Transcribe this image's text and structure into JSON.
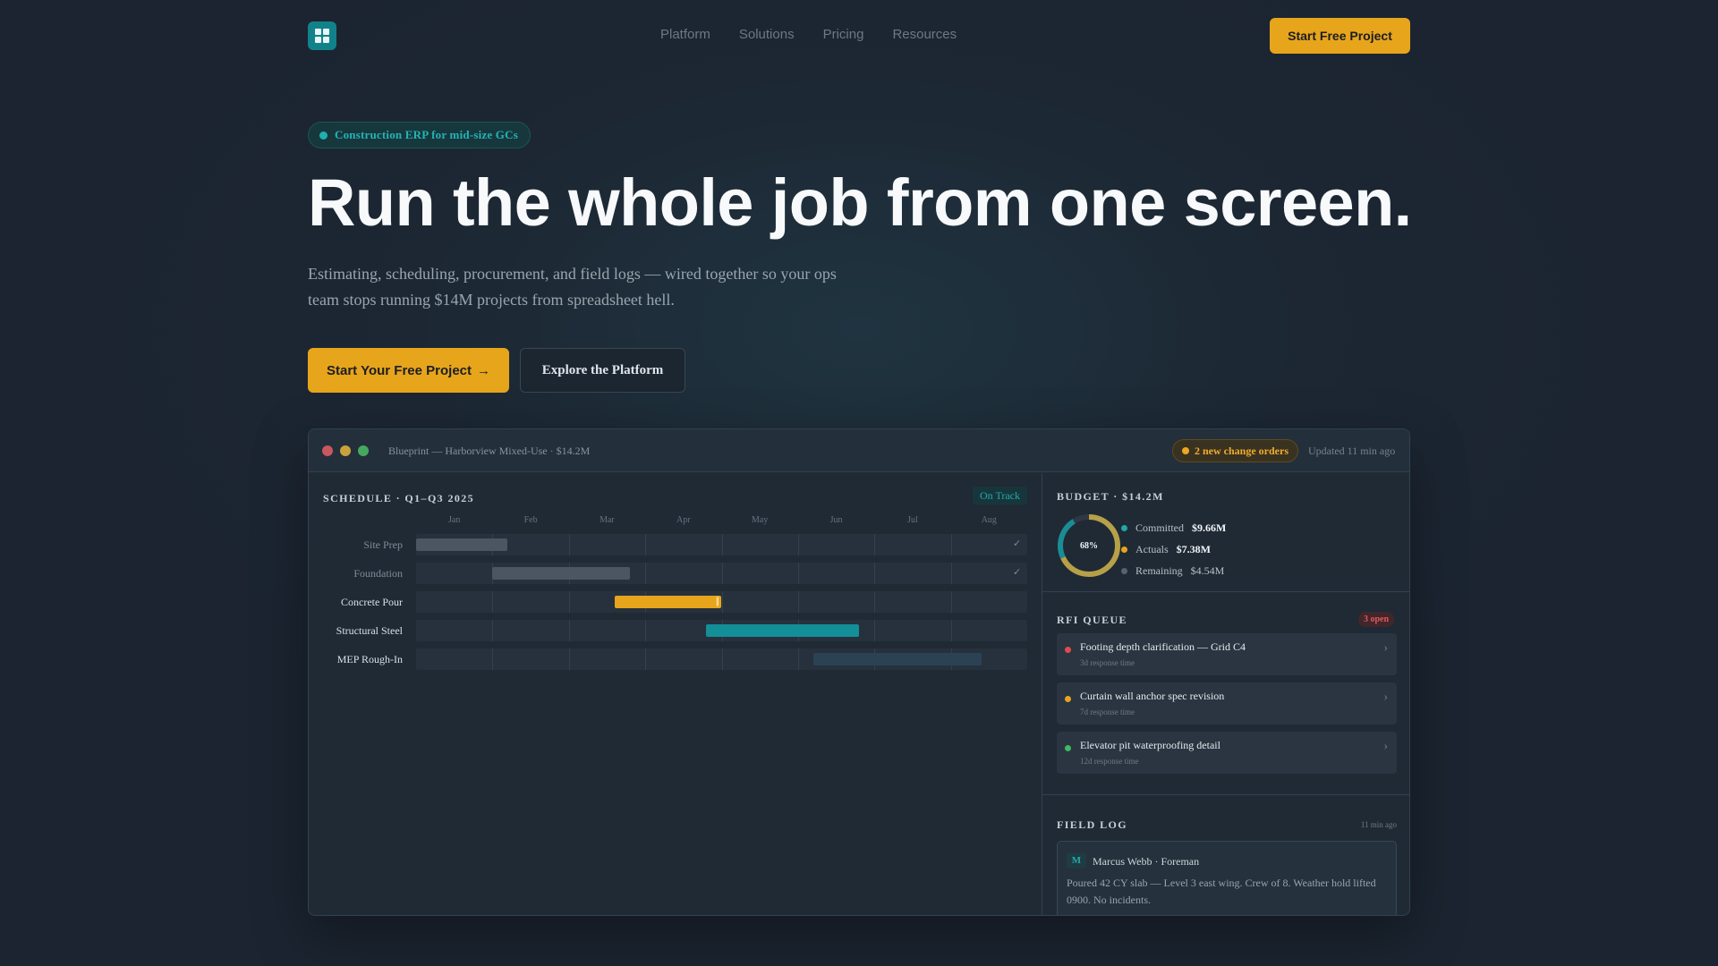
{
  "nav": {
    "links": [
      "Platform",
      "Solutions",
      "Pricing",
      "Resources"
    ],
    "cta": "Start Free Project"
  },
  "hero": {
    "pill": "Construction ERP for mid-size GCs",
    "title": "Run the whole job from one screen.",
    "subtitle": "Estimating, scheduling, procurement, and field logs — wired together so your ops team stops running $14M projects from spreadsheet hell.",
    "primary_cta": "Start Your Free Project",
    "primary_cta_arrow": "→",
    "secondary_cta": "Explore the Platform"
  },
  "window": {
    "title": "Blueprint — Harborview Mixed-Use · $14.2M",
    "change_orders": "2 new change orders",
    "updated": "Updated 11 min ago"
  },
  "schedule": {
    "title": "SCHEDULE · Q1–Q3 2025",
    "status": "On Track",
    "months": [
      "Jan",
      "Feb",
      "Mar",
      "Apr",
      "May",
      "Jun",
      "Jul",
      "Aug"
    ],
    "tasks": [
      {
        "name": "Site Prep",
        "start": 0.0,
        "end": 1.2,
        "state": "done",
        "color": "#4b5660"
      },
      {
        "name": "Foundation",
        "start": 1.0,
        "end": 2.8,
        "state": "done",
        "color": "#4b5660"
      },
      {
        "name": "Concrete Pour",
        "start": 2.6,
        "end": 4.0,
        "state": "active",
        "color": "#e7a51c"
      },
      {
        "name": "Structural Steel",
        "start": 3.8,
        "end": 5.8,
        "state": "upcoming",
        "color": "#138f98"
      },
      {
        "name": "MEP Rough-In",
        "start": 5.2,
        "end": 7.4,
        "state": "planned",
        "color": "#2b4254"
      }
    ],
    "done_mark": "✓",
    "active_mark": "||"
  },
  "budget": {
    "title": "BUDGET · $14.2M",
    "percent_label": "68%",
    "percent": 0.68,
    "items": [
      {
        "label": "Committed",
        "value": "$9.66M",
        "color": "#1fa7ad"
      },
      {
        "label": "Actuals",
        "value": "$7.38M",
        "color": "#e7a51c"
      },
      {
        "label": "Remaining",
        "value": "$4.54M",
        "color": "#56636e"
      }
    ]
  },
  "rfi": {
    "title": "RFI QUEUE",
    "open_count": "3 open",
    "items": [
      {
        "name": "Footing depth clarification — Grid C4",
        "meta": "3d response time",
        "color": "#e24b4b"
      },
      {
        "name": "Curtain wall anchor spec revision",
        "meta": "7d response time",
        "color": "#e7a51c"
      },
      {
        "name": "Elevator pit waterproofing detail",
        "meta": "12d response time",
        "color": "#3cba62"
      }
    ],
    "chevron": "›"
  },
  "field_log": {
    "title": "FIELD LOG",
    "time": "11 min ago",
    "avatar": "M",
    "author": "Marcus Webb · Foreman",
    "text": "Poured 42 CY slab — Level 3 east wing. Crew of 8. Weather hold lifted 0900. No incidents."
  },
  "colors": {
    "accent": "#e7a51c",
    "teal": "#1fa7ad",
    "background": "#1c2733"
  }
}
